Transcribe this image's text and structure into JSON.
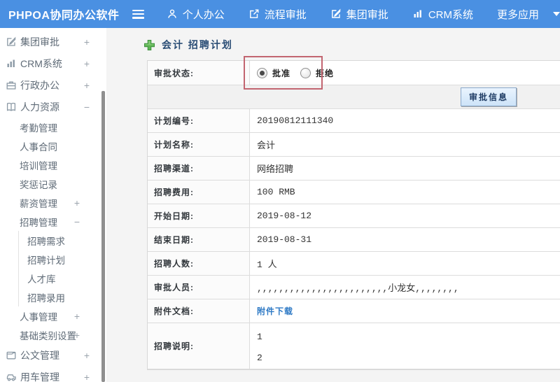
{
  "colors": {
    "topbar_blue": "#4a90e2",
    "annotation_red": "#c26570",
    "link_blue": "#2f7ac5",
    "title_navy": "#2a4d75",
    "plus_green": "#5db452"
  },
  "topbar": {
    "logo": "PHPOA协同办公软件",
    "nav": [
      {
        "label": "个人办公",
        "icon": "person-icon"
      },
      {
        "label": "流程审批",
        "icon": "flow-icon"
      },
      {
        "label": "集团审批",
        "icon": "edit-square-icon"
      },
      {
        "label": "CRM系统",
        "icon": "bar-chart-icon"
      },
      {
        "label": "更多应用",
        "icon": "caret-down-icon"
      }
    ]
  },
  "sidebar": {
    "items": [
      {
        "label": "集团审批",
        "level": 1,
        "icon": "edit-square-icon",
        "expander": "+"
      },
      {
        "label": "CRM系统",
        "level": 1,
        "icon": "bar-chart-icon",
        "expander": "+"
      },
      {
        "label": "行政办公",
        "level": 1,
        "icon": "briefcase-icon",
        "expander": "+"
      },
      {
        "label": "人力资源",
        "level": 1,
        "icon": "book-icon",
        "expander": "−"
      },
      {
        "label": "考勤管理",
        "level": 2
      },
      {
        "label": "人事合同",
        "level": 2
      },
      {
        "label": "培训管理",
        "level": 2
      },
      {
        "label": "奖惩记录",
        "level": 2
      },
      {
        "label": "薪资管理",
        "level": 2,
        "expander": "+"
      },
      {
        "label": "招聘管理",
        "level": 2,
        "expander": "−"
      },
      {
        "label": "招聘需求",
        "level": 3
      },
      {
        "label": "招聘计划",
        "level": 3
      },
      {
        "label": "人才库",
        "level": 3
      },
      {
        "label": "招聘录用",
        "level": 3
      },
      {
        "label": "人事管理",
        "level": 2,
        "expander": "+"
      },
      {
        "label": "基础类别设置",
        "level": 2,
        "expander": "+"
      },
      {
        "label": "公文管理",
        "level": 1,
        "icon": "document-icon",
        "expander": "+"
      },
      {
        "label": "用车管理",
        "level": 1,
        "icon": "car-icon",
        "expander": "+"
      }
    ]
  },
  "main": {
    "title": "会计 招聘计划",
    "approval": {
      "status_label": "审批状态:",
      "options": [
        {
          "label": "批准",
          "selected": true
        },
        {
          "label": "拒绝",
          "selected": false
        }
      ],
      "button_label": "审批信息"
    },
    "rows": [
      {
        "label": "计划编号:",
        "value": "20190812111340"
      },
      {
        "label": "计划名称:",
        "value": "会计"
      },
      {
        "label": "招聘渠道:",
        "value": "网络招聘"
      },
      {
        "label": "招聘费用:",
        "value": "100 RMB"
      },
      {
        "label": "开始日期:",
        "value": "2019-08-12"
      },
      {
        "label": "结束日期:",
        "value": "2019-08-31"
      },
      {
        "label": "招聘人数:",
        "value": "1 人"
      },
      {
        "label": "审批人员:",
        "value": ",,,,,,,,,,,,,,,,,,,,,,,,小龙女,,,,,,,,"
      },
      {
        "label": "附件文档:",
        "value": "附件下载"
      },
      {
        "label": "招聘说明:",
        "lines": [
          "1",
          "2"
        ]
      }
    ]
  }
}
